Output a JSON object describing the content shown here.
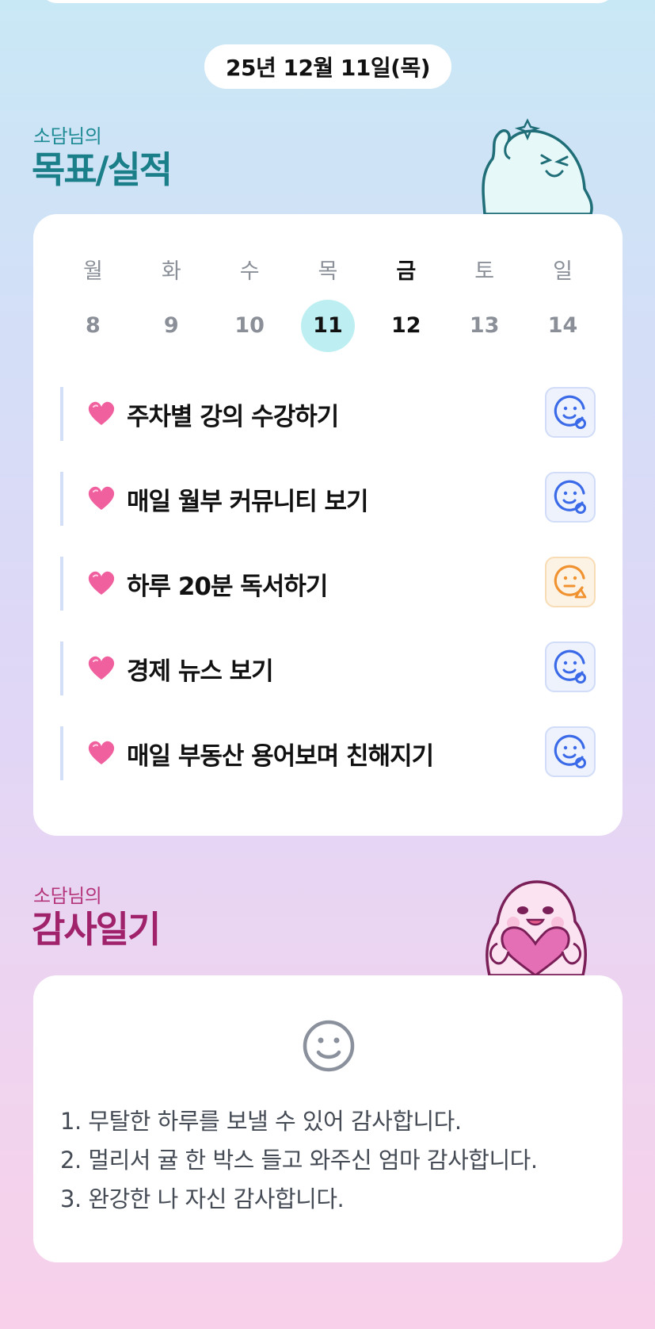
{
  "header": {
    "date": "25년 12월 11일(목)"
  },
  "goals_section": {
    "subtitle": "소담님의",
    "title": "목표/실적",
    "weekdays": [
      "월",
      "화",
      "수",
      "목",
      "금",
      "토",
      "일"
    ],
    "days": [
      "8",
      "9",
      "10",
      "11",
      "12",
      "13",
      "14"
    ],
    "today_index": 3,
    "active_index": 4,
    "items": [
      {
        "label": "주차별 강의 수강하기",
        "status": "good",
        "icon": "smile-check-icon"
      },
      {
        "label": "매일 월부 커뮤니티 보기",
        "status": "good",
        "icon": "smile-check-icon"
      },
      {
        "label": "하루 20분 독서하기",
        "status": "warn",
        "icon": "neutral-triangle-icon"
      },
      {
        "label": "경제 뉴스 보기",
        "status": "good",
        "icon": "smile-check-icon"
      },
      {
        "label": "매일 부동산 용어보며 친해지기",
        "status": "good",
        "icon": "smile-check-icon"
      }
    ],
    "colors": {
      "good": "#3a6ae8",
      "warn": "#f0922f",
      "heart": "#f0609f",
      "accent": "#1b7f8a"
    }
  },
  "thanks_section": {
    "subtitle": "소담님의",
    "title": "감사일기",
    "lines": [
      "1. 무탈한 하루를 보낼 수 있어 감사합니다.",
      "2. 멀리서 귤 한 박스 들고 와주신 엄마 감사합니다.",
      "3. 완강한 나 자신 감사합니다."
    ],
    "colors": {
      "accent": "#a0226b"
    }
  }
}
